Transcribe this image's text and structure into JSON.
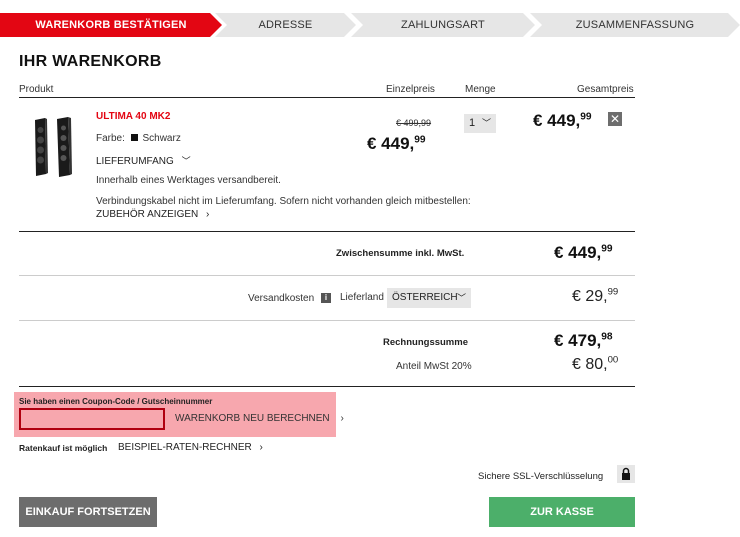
{
  "steps": [
    "WARENKORB BESTÄTIGEN",
    "ADRESSE",
    "ZAHLUNGSART",
    "ZUSAMMENFASSUNG"
  ],
  "title": "IHR WARENKORB",
  "columns": {
    "product": "Produkt",
    "unit_price": "Einzelpreis",
    "quantity": "Menge",
    "total": "Gesamtpreis"
  },
  "item": {
    "name": "ULTIMA 40 MK2",
    "color_label": "Farbe:",
    "color_value": "Schwarz",
    "delivery_scope": "LIEFERUMFANG",
    "old_price": "€ 499,99",
    "price_main": "€ 449,",
    "price_cents": "99",
    "quantity": "1",
    "total_main": "€ 449,",
    "total_cents": "99",
    "shipping_note": "Innerhalb eines Werktages versandbereit.",
    "cable_note": "Verbindungskabel nicht im Lieferumfang. Sofern nicht vorhanden gleich mitbestellen:",
    "accessories_link": "ZUBEHÖR ANZEIGEN"
  },
  "subtotal": {
    "label": "Zwischensumme inkl. MwSt.",
    "main": "€ 449,",
    "cents": "99"
  },
  "shipping": {
    "label": "Versandkosten",
    "country_label": "Lieferland",
    "country": "ÖSTERREICH",
    "main": "€ 29,",
    "cents": "99"
  },
  "invoice_total": {
    "label": "Rechnungssumme",
    "main": "€ 479,",
    "cents": "98"
  },
  "vat": {
    "label": "Anteil MwSt 20%",
    "main": "€ 80,",
    "cents": "00"
  },
  "coupon": {
    "label": "Sie haben einen Coupon-Code / Gutscheinnummer",
    "recalc": "WARENKORB NEU BERECHNEN",
    "value": ""
  },
  "installment": {
    "label": "Ratenkauf ist möglich",
    "link": "BEISPIEL-RATEN-RECHNER"
  },
  "ssl": "Sichere SSL-Verschlüsselung",
  "buttons": {
    "continue": "EINKAUF FORTSETZEN",
    "checkout": "ZUR KASSE"
  },
  "colors": {
    "accent": "#e30613",
    "checkout": "#4caf6a",
    "grey_button": "#6d6d6d"
  }
}
